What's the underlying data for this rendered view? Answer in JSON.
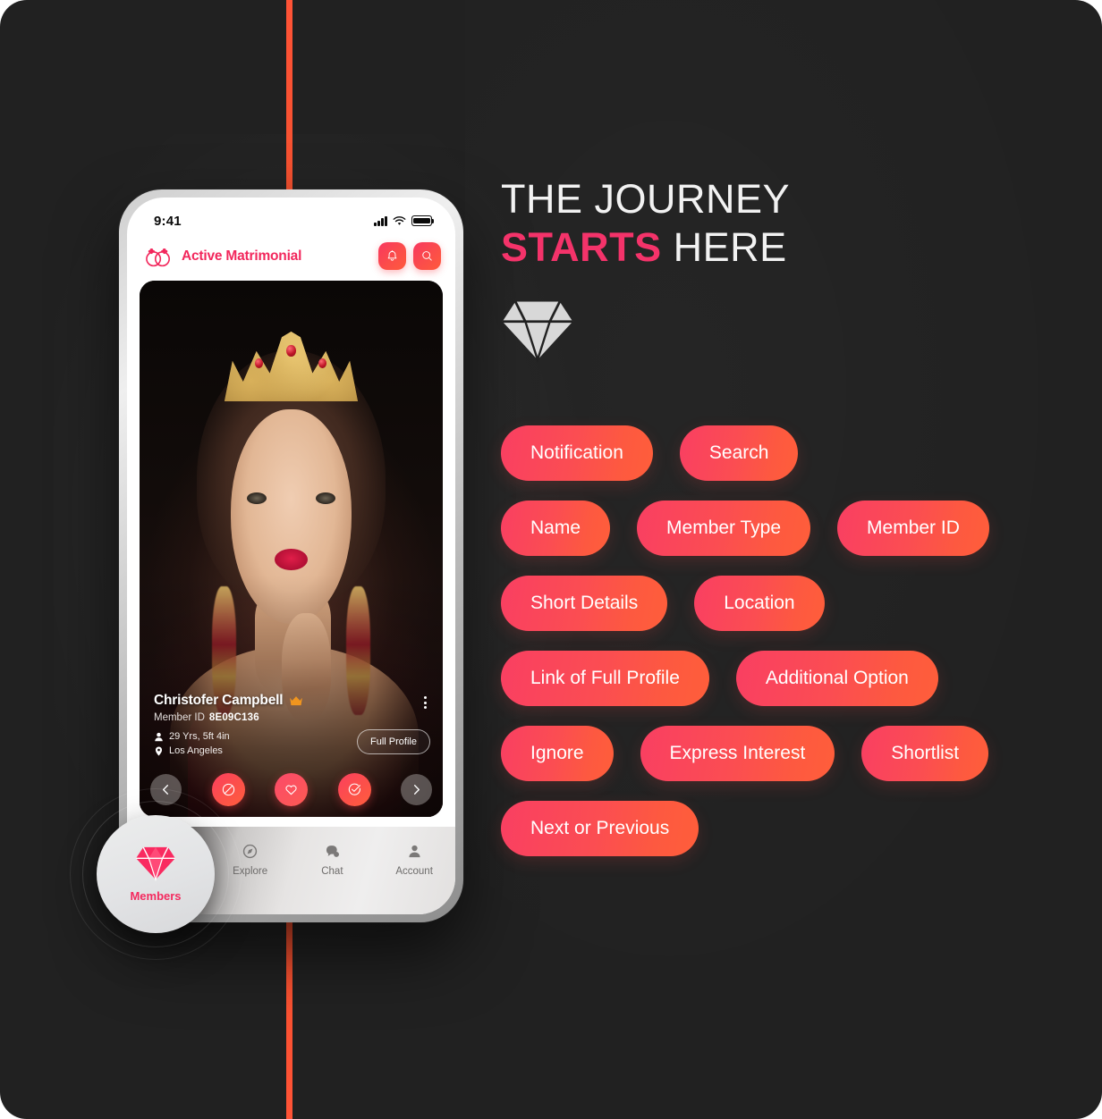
{
  "phone": {
    "status_bar": {
      "time": "9:41"
    },
    "app_header": {
      "brand_name": "Active Matrimonial",
      "notification_icon": "bell-icon",
      "search_icon": "search-icon"
    },
    "member_card": {
      "name": "Christofer Campbell",
      "crown_icon": "crown-icon",
      "member_id_label": "Member ID",
      "member_id_value": "8E09C136",
      "age_height": "29 Yrs, 5ft 4in",
      "location": "Los Angeles",
      "full_profile_label": "Full Profile",
      "more_icon": "kebab-menu-icon",
      "actions": [
        {
          "name": "previous",
          "icon": "chevron-left-icon"
        },
        {
          "name": "ignore",
          "icon": "block-circle-icon"
        },
        {
          "name": "express-interest",
          "icon": "heart-icon"
        },
        {
          "name": "shortlist",
          "icon": "check-circle-icon"
        },
        {
          "name": "next",
          "icon": "chevron-right-icon"
        }
      ]
    },
    "bottom_nav": [
      {
        "label": "Members",
        "icon": "diamond-icon",
        "active": true
      },
      {
        "label": "Explore",
        "icon": "compass-icon",
        "active": false
      },
      {
        "label": "Chat",
        "icon": "chat-bubble-icon",
        "active": false
      },
      {
        "label": "Account",
        "icon": "person-icon",
        "active": false
      }
    ]
  },
  "right_panel": {
    "headline_line1": "THE JOURNEY",
    "headline_strong": "STARTS",
    "headline_tail": " HERE",
    "diamond_icon": "diamond-icon",
    "feature_rows": [
      [
        "Notification",
        "Search"
      ],
      [
        "Name",
        "Member Type",
        "Member ID"
      ],
      [
        "Short Details",
        "Location"
      ],
      [
        "Link of Full Profile",
        "Additional Option"
      ],
      [
        "Ignore",
        "Express Interest",
        "Shortlist"
      ],
      [
        "Next or Previous"
      ]
    ]
  },
  "colors": {
    "background": "#212121",
    "accent_pink": "#f4336a",
    "accent_orange": "#ff5e3a",
    "brand_pink": "#f2275c",
    "line_top": "#ff5336"
  }
}
